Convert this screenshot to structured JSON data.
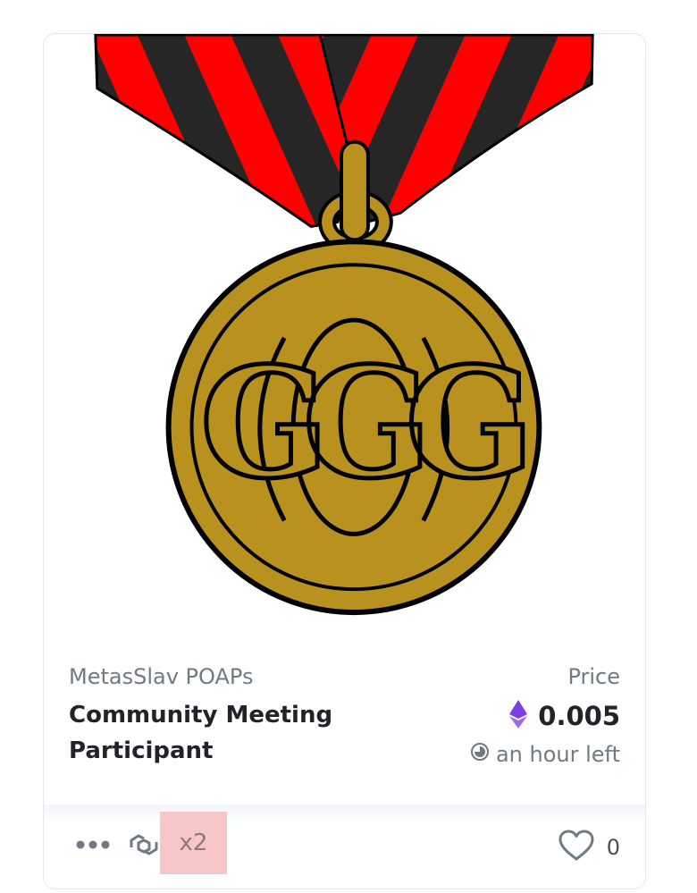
{
  "item": {
    "collection": "MetasSlav POAPs",
    "title": "Community Meeting Participant",
    "price_label": "Price",
    "price_value": "0.005",
    "currency_icon": "ethereum-icon",
    "time_left": "an hour left",
    "quantity": "x2",
    "likes": "0",
    "media_monogram": "GGG"
  },
  "colors": {
    "ribbon_red": "#ff0000",
    "ribbon_black": "#262626",
    "medal_gold": "#b8911f",
    "ethereum_purple": "#7b3fe4",
    "quantity_highlight": "#f7c6c8"
  },
  "icons": [
    "more-icon",
    "chain-link-icon",
    "heart-icon",
    "clock-icon",
    "ethereum-icon"
  ]
}
